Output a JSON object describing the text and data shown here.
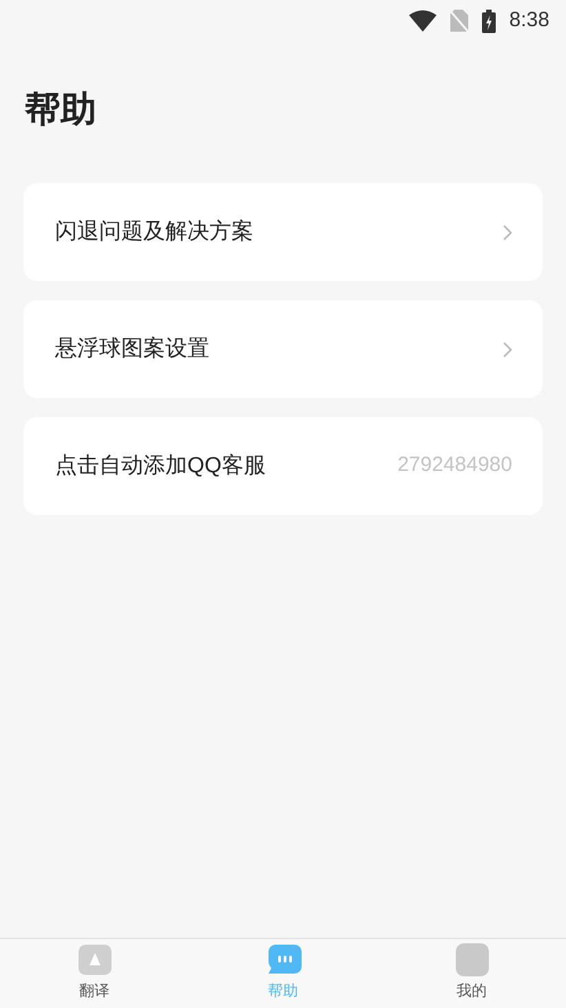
{
  "status_bar": {
    "time": "8:38"
  },
  "title": "帮助",
  "items": [
    {
      "label": "闪退问题及解决方案",
      "kind": "link"
    },
    {
      "label": "悬浮球图案设置",
      "kind": "link"
    },
    {
      "label": "点击自动添加QQ客服",
      "kind": "value",
      "value": "2792484980"
    }
  ],
  "tabs": [
    {
      "label": "翻译",
      "kind": "translate",
      "selected": false
    },
    {
      "label": "帮助",
      "kind": "help",
      "selected": true
    },
    {
      "label": "我的",
      "kind": "me",
      "selected": false
    }
  ]
}
